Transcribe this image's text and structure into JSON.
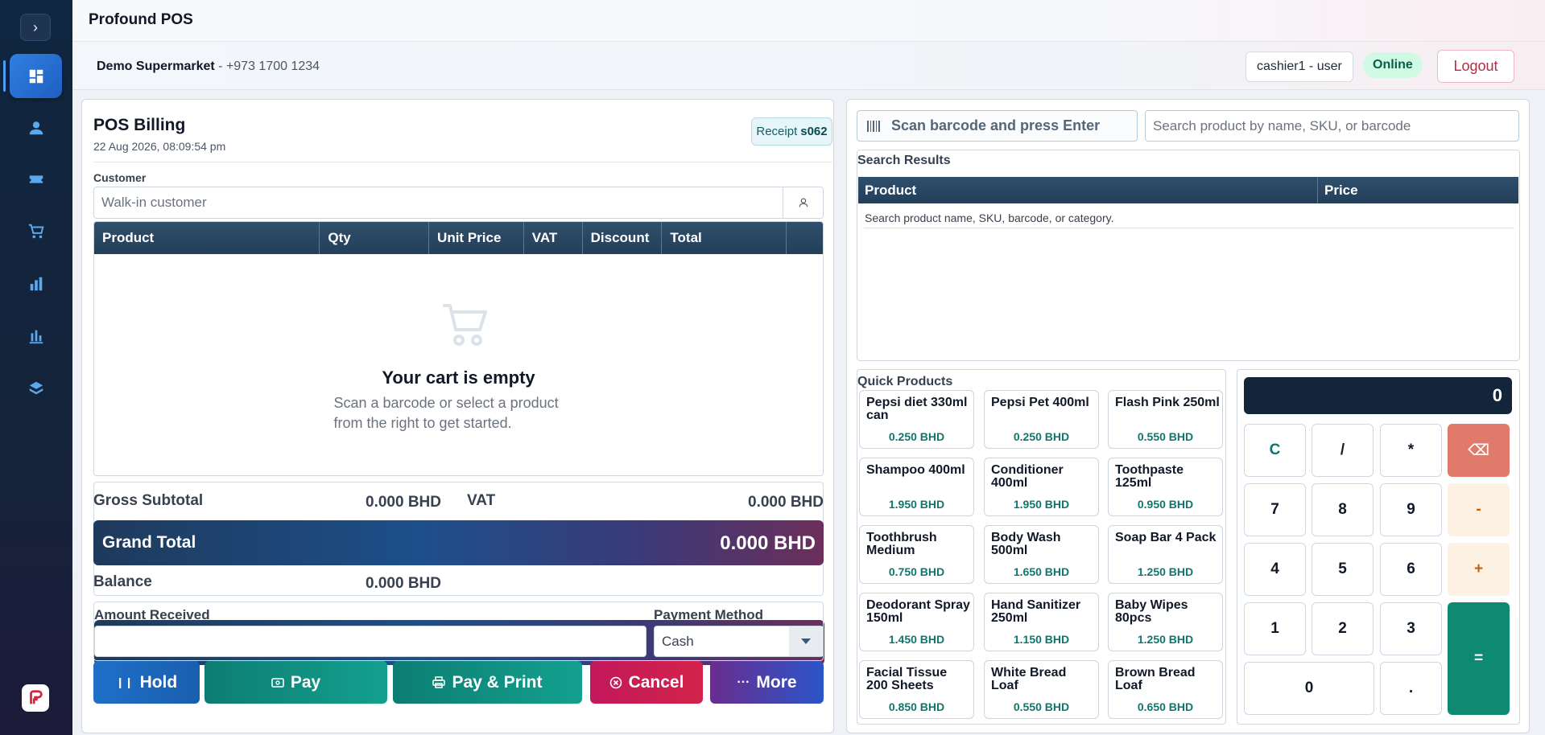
{
  "app": {
    "title": "Profound POS"
  },
  "header": {
    "store_name": "Demo Supermarket",
    "store_sep": " - ",
    "store_phone": "+973 1700 1234",
    "user": "cashier1 - user",
    "status": "Online",
    "logout": "Logout"
  },
  "sidebar": {
    "items": [
      {
        "icon": "dashboard-icon",
        "active": true
      },
      {
        "icon": "user-icon",
        "active": false
      },
      {
        "icon": "ticket-icon",
        "active": false
      },
      {
        "icon": "cart-icon",
        "active": false
      },
      {
        "icon": "bar-chart-icon",
        "active": false
      },
      {
        "icon": "stats-icon",
        "active": false
      },
      {
        "icon": "layers-icon",
        "active": false
      }
    ]
  },
  "billing": {
    "title": "POS Billing",
    "date": "22 Aug 2026, 08:09:54 pm",
    "receipt_label": "Receipt",
    "receipt_no": "s062",
    "customer_label": "Customer",
    "customer_placeholder": "Walk-in customer",
    "columns": [
      "Product",
      "Qty",
      "Unit Price",
      "VAT",
      "Discount",
      "Total"
    ],
    "empty_title": "Your cart is empty",
    "empty_sub": "Scan a barcode or select a product from the right to get started."
  },
  "totals": {
    "gross_label": "Gross Subtotal",
    "gross_value": "0.000 BHD",
    "vat_label": "VAT",
    "vat_value": "0.000 BHD",
    "grand_label": "Grand Total",
    "grand_value": "0.000 BHD",
    "balance_label": "Balance",
    "balance_value": "0.000 BHD"
  },
  "payment": {
    "amount_label": "Amount Received",
    "amount_value": "",
    "method_label": "Payment Method",
    "method_value": "Cash"
  },
  "actions": {
    "hold": "Hold",
    "pay": "Pay",
    "pay_print": "Pay & Print",
    "cancel": "Cancel",
    "more": "More"
  },
  "search": {
    "scan_placeholder": "Scan barcode and press Enter",
    "search_placeholder": "Search product by name, SKU, or barcode",
    "results_title": "Search Results",
    "columns": [
      "Product",
      "Price"
    ],
    "empty_text": "Search product name, SKU, barcode, or category."
  },
  "quick_products": {
    "title": "Quick Products",
    "items": [
      {
        "name": "Pepsi diet 330ml can",
        "price": "0.250 BHD"
      },
      {
        "name": "Pepsi Pet 400ml",
        "price": "0.250 BHD"
      },
      {
        "name": "Flash Pink 250ml",
        "price": "0.550 BHD"
      },
      {
        "name": "Shampoo 400ml",
        "price": "1.950 BHD"
      },
      {
        "name": "Conditioner 400ml",
        "price": "1.950 BHD"
      },
      {
        "name": "Toothpaste 125ml",
        "price": "0.950 BHD"
      },
      {
        "name": "Toothbrush Medium",
        "price": "0.750 BHD"
      },
      {
        "name": "Body Wash 500ml",
        "price": "1.650 BHD"
      },
      {
        "name": "Soap Bar 4 Pack",
        "price": "1.250 BHD"
      },
      {
        "name": "Deodorant Spray 150ml",
        "price": "1.450 BHD"
      },
      {
        "name": "Hand Sanitizer 250ml",
        "price": "1.150 BHD"
      },
      {
        "name": "Baby Wipes 80pcs",
        "price": "1.250 BHD"
      },
      {
        "name": "Facial Tissue 200 Sheets",
        "price": "0.850 BHD"
      },
      {
        "name": "White Bread Loaf",
        "price": "0.550 BHD"
      },
      {
        "name": "Brown Bread Loaf",
        "price": "0.650 BHD"
      }
    ]
  },
  "calculator": {
    "display": "0",
    "keys": [
      "C",
      "/",
      "*",
      "⌫",
      "7",
      "8",
      "9",
      "-",
      "4",
      "5",
      "6",
      "+",
      "1",
      "2",
      "3",
      "=",
      "0",
      "."
    ]
  }
}
